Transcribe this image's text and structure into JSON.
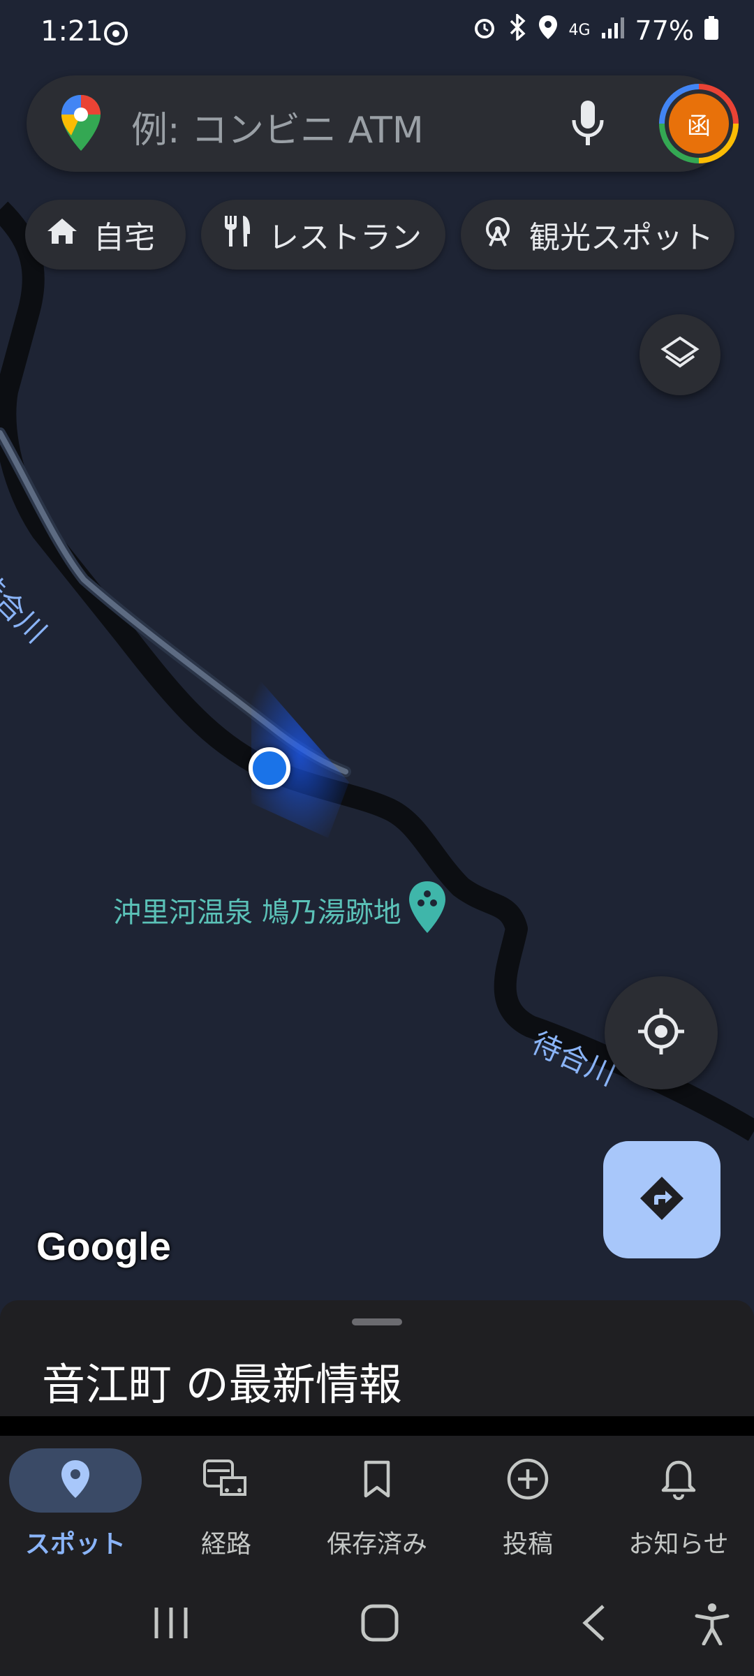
{
  "status_bar": {
    "time": "1:21",
    "battery": "77%",
    "network": "4G"
  },
  "search": {
    "placeholder": "例: コンビニ ATM",
    "avatar_text": "函"
  },
  "chips": [
    {
      "label": "自宅",
      "icon": "home-icon"
    },
    {
      "label": "レストラン",
      "icon": "restaurant-icon"
    },
    {
      "label": "観光スポット",
      "icon": "attraction-icon"
    }
  ],
  "map": {
    "river_label_1": "待合川",
    "river_label_2": "待合川",
    "poi_label": "沖里河温泉 鳩乃湯跡地",
    "attribution": "Google"
  },
  "sheet": {
    "title": "音江町 の最新情報"
  },
  "nav": [
    {
      "label": "スポット",
      "icon": "place-icon",
      "active": true
    },
    {
      "label": "経路",
      "icon": "commute-icon",
      "active": false
    },
    {
      "label": "保存済み",
      "icon": "bookmark-icon",
      "active": false
    },
    {
      "label": "投稿",
      "icon": "add-circle-icon",
      "active": false
    },
    {
      "label": "お知らせ",
      "icon": "bell-icon",
      "active": false
    }
  ],
  "colors": {
    "map_bg": "#1e2434",
    "accent": "#8ab4f8",
    "location_dot": "#1a73e8"
  }
}
